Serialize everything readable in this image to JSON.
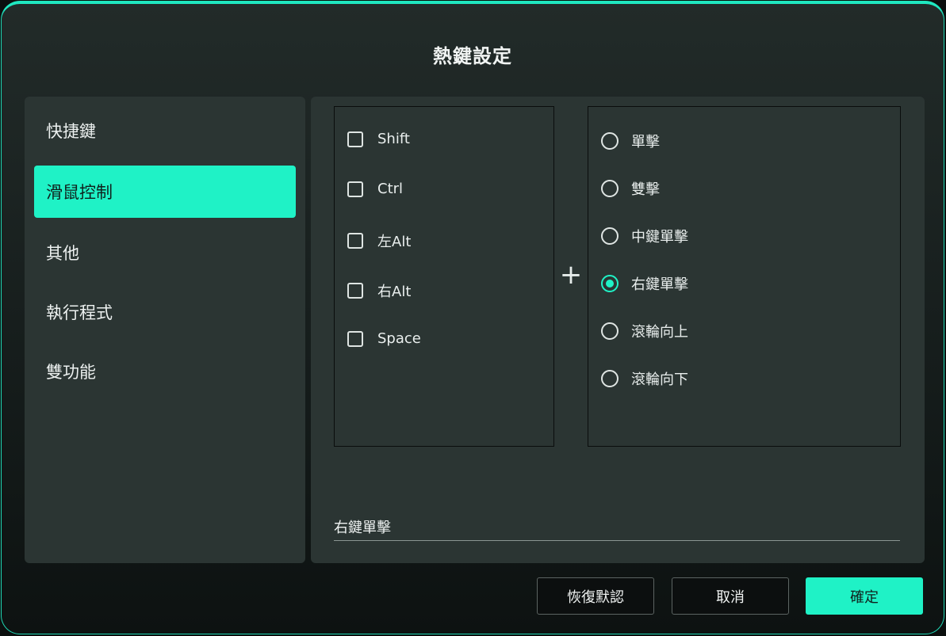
{
  "dialog": {
    "title": "熱鍵設定"
  },
  "sidebar": {
    "items": [
      {
        "label": "快捷鍵",
        "active": false
      },
      {
        "label": "滑鼠控制",
        "active": true
      },
      {
        "label": "其他",
        "active": false
      },
      {
        "label": "執行程式",
        "active": false
      },
      {
        "label": "雙功能",
        "active": false
      }
    ]
  },
  "modifiers": [
    {
      "label": "Shift",
      "checked": false
    },
    {
      "label": "Ctrl",
      "checked": false
    },
    {
      "label": "左Alt",
      "checked": false
    },
    {
      "label": "右Alt",
      "checked": false
    },
    {
      "label": "Space",
      "checked": false
    }
  ],
  "plus_symbol": "+",
  "mouse_actions": [
    {
      "label": "單擊",
      "selected": false
    },
    {
      "label": "雙擊",
      "selected": false
    },
    {
      "label": "中鍵單擊",
      "selected": false
    },
    {
      "label": "右鍵單擊",
      "selected": true
    },
    {
      "label": "滾輪向上",
      "selected": false
    },
    {
      "label": "滾輪向下",
      "selected": false
    }
  ],
  "result": {
    "value": "右鍵單擊"
  },
  "buttons": {
    "restore_default": "恢復默認",
    "cancel": "取消",
    "confirm": "確定"
  },
  "colors": {
    "accent": "#1ff2c6",
    "panel": "#2b3533",
    "background": "#161d1c"
  }
}
